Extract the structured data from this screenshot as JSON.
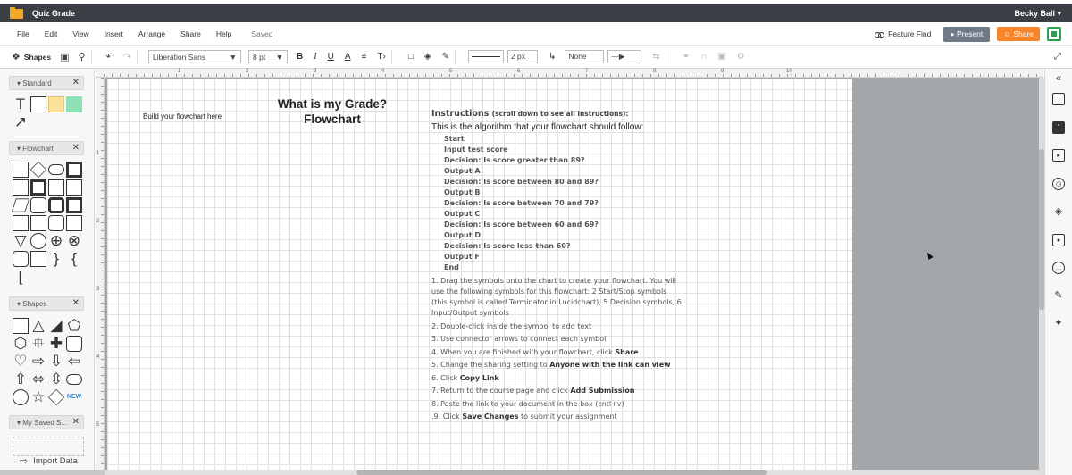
{
  "window": {
    "doc_title": "Quiz Grade",
    "user": "Becky Ball ▾"
  },
  "menu": {
    "items": [
      "File",
      "Edit",
      "View",
      "Insert",
      "Arrange",
      "Share",
      "Help"
    ],
    "saved": "Saved",
    "feature_find": "Feature Find",
    "present": "▸ Present",
    "share": "Share"
  },
  "toolbar": {
    "shapes_label": "Shapes",
    "font": "Liberation Sans",
    "font_size": "8 pt",
    "bold": "B",
    "italic": "I",
    "underline": "U",
    "font_color": "A",
    "line_width": "2 px",
    "endpoint": "None",
    "dropdown_arrow": "▼"
  },
  "left_panel": {
    "sections": [
      {
        "label": "▾ Standard"
      },
      {
        "label": "▾ Flowchart"
      },
      {
        "label": "▾ Shapes"
      },
      {
        "label": "▾ My Saved S..."
      }
    ],
    "close": "✕",
    "new_badge": "NEW",
    "import_data": "Import Data"
  },
  "ruler_numbers": [
    "1",
    "2",
    "3",
    "4",
    "5",
    "6",
    "7",
    "8",
    "9",
    "10"
  ],
  "ruler_left_numbers": [
    "1",
    "2",
    "3",
    "4",
    "5"
  ],
  "page": {
    "subtitle": "Build your flowchart here",
    "title_line1": "What is my Grade?",
    "title_line2": "Flowchart",
    "instructions_head": "Instructions",
    "instructions_note": "(scroll down to see all instructions):",
    "instructions_line": "This is the algorithm that your flowchart should follow:",
    "algorithm": [
      "Start",
      "Input test score",
      "Decision: Is score greater than 89?",
      "Output A",
      "Decision: Is score between 80 and 89?",
      "Output B",
      "Decision: Is score between 70 and 79?",
      "Output C",
      "Decision: Is score between 60 and 69?",
      "Output D",
      "Decision: Is score less than 60?",
      "Output F",
      "End"
    ],
    "steps": {
      "s1": "1. Drag the symbols onto the chart to create your flowchart. You will use the following symbols for this flowchart: 2 Start/Stop symbols (this symbol is called Terminator in Lucidchart), 5 Decision symbols, 6 Input/Output symbols",
      "s2": "2. Double-click inside the symbol to add text",
      "s3": "3. Use connector arrows to connect each symbol",
      "s4_pre": "4. When you are finished with your flowchart, click ",
      "s4_bold": "Share",
      "s5_pre": "5. Change the sharing setting to ",
      "s5_bold": "Anyone with the link can view",
      "s6_pre": "6. Click ",
      "s6_bold": "Copy Link",
      "s7_pre": "7. Return to the course page and click ",
      "s7_bold": "Add Submission",
      "s8": "8. Paste the link to your document in the box (cntl+v)",
      "s9_pre": ".9. Click ",
      "s9_bold": "Save Changes",
      "s9_post": " to submit your assignment"
    }
  },
  "colors": {
    "titlebar": "#3a3f45",
    "share_button": "#f6842b",
    "present_button": "#6f7a86",
    "canvas_gray": "#a3a7aa"
  }
}
